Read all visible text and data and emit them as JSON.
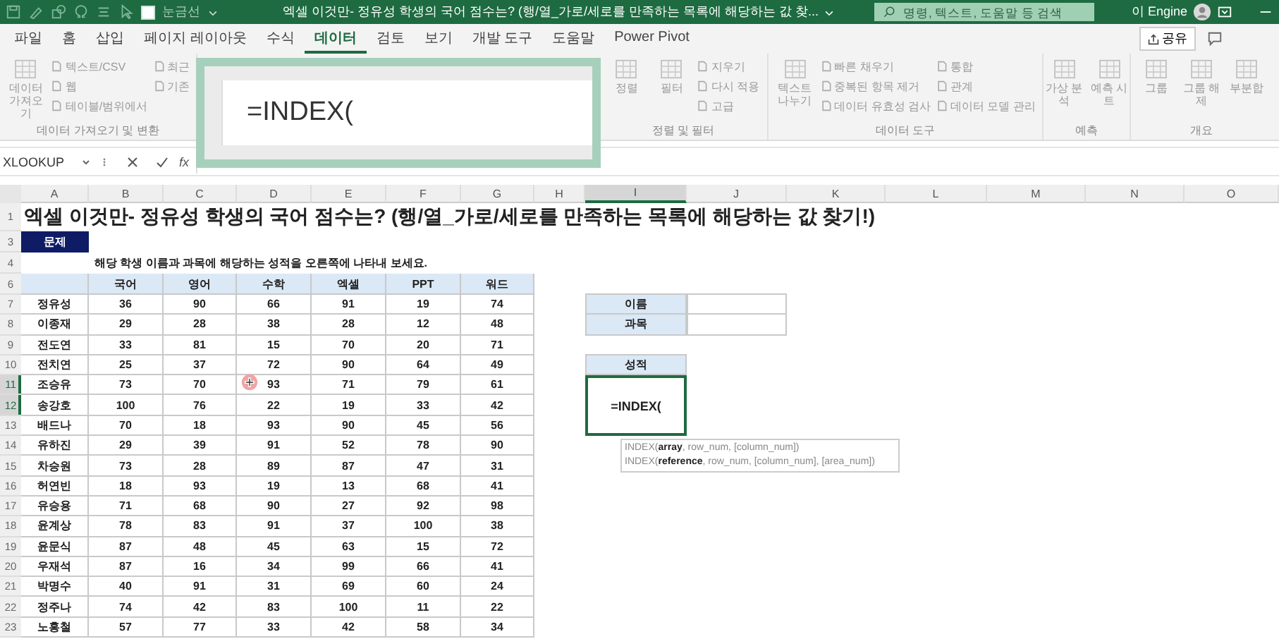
{
  "title_bar": {
    "gridlines_label": "눈금선",
    "gridlines_checked": false,
    "title": "엑셀 이것만- 정유성 학생의 국어 점수는? (행/열_가로/세로를 만족하는 목록에 해당하는 값 찾...",
    "search_placeholder": "명령, 텍스트, 도움말 등 검색",
    "user": "이 Engine"
  },
  "tabs": [
    {
      "label": "파일",
      "selected": false
    },
    {
      "label": "홈",
      "selected": false
    },
    {
      "label": "삽입",
      "selected": false
    },
    {
      "label": "페이지 레이아웃",
      "selected": false
    },
    {
      "label": "수식",
      "selected": false
    },
    {
      "label": "데이터",
      "selected": true
    },
    {
      "label": "검토",
      "selected": false
    },
    {
      "label": "보기",
      "selected": false
    },
    {
      "label": "개발 도구",
      "selected": false
    },
    {
      "label": "도움말",
      "selected": false
    },
    {
      "label": "Power Pivot",
      "selected": false
    }
  ],
  "share_label": "공유",
  "ribbon_groups": [
    {
      "label": "데이터 가져오기 및 변환",
      "columns": [
        {
          "kind": "large",
          "items": [
            "데이터 가져오기"
          ]
        },
        {
          "kind": "small",
          "items": [
            "텍스트/CSV",
            "웹",
            "테이블/범위에서"
          ]
        },
        {
          "kind": "small",
          "items": [
            "최근",
            "기존"
          ]
        }
      ]
    },
    {
      "label": "정렬 및 필터",
      "columns": [
        {
          "kind": "large",
          "items": [
            "정렬"
          ]
        },
        {
          "kind": "large",
          "items": [
            "필터"
          ]
        },
        {
          "kind": "small",
          "items": [
            "지우기",
            "다시 적용",
            "고급"
          ]
        }
      ]
    },
    {
      "label": "데이터 도구",
      "columns": [
        {
          "kind": "large",
          "items": [
            "텍스트 나누기"
          ]
        },
        {
          "kind": "small",
          "items": [
            "빠른 채우기",
            "중복된 항목 제거",
            "데이터 유효성 검사"
          ]
        },
        {
          "kind": "small",
          "items": [
            "통합",
            "관계",
            "데이터 모델 관리"
          ]
        }
      ]
    },
    {
      "label": "예측",
      "columns": [
        {
          "kind": "large",
          "items": [
            "가상 분석"
          ]
        },
        {
          "kind": "large",
          "items": [
            "예측 시트"
          ]
        }
      ]
    },
    {
      "label": "개요",
      "columns": [
        {
          "kind": "large",
          "items": [
            "그룹"
          ]
        },
        {
          "kind": "large",
          "items": [
            "그룹 해제"
          ]
        },
        {
          "kind": "large",
          "items": [
            "부분합"
          ]
        }
      ]
    }
  ],
  "formula_bar": {
    "name_box": "XLOOKUP",
    "function_label": "fx"
  },
  "formula_zoom": {
    "text": "=INDEX("
  },
  "sheet": {
    "columns": [
      {
        "label": "A",
        "selected": false
      },
      {
        "label": "B",
        "selected": false
      },
      {
        "label": "C",
        "selected": false
      },
      {
        "label": "D",
        "selected": false
      },
      {
        "label": "E",
        "selected": false
      },
      {
        "label": "F",
        "selected": false
      },
      {
        "label": "G",
        "selected": false
      },
      {
        "label": "H",
        "selected": false
      },
      {
        "label": "I",
        "selected": true
      },
      {
        "label": "J",
        "selected": false
      },
      {
        "label": "K",
        "selected": false
      },
      {
        "label": "L",
        "selected": false
      },
      {
        "label": "M",
        "selected": false
      },
      {
        "label": "N",
        "selected": false
      },
      {
        "label": "O",
        "selected": false
      }
    ],
    "rows": [
      {
        "number": "1",
        "selected": false,
        "kind": "title",
        "text": "엑셀 이것만- 정유성 학생의 국어 점수는? (행/열_가로/세로를 만족하는 목록에 해당하는 값 찾기!)"
      },
      {
        "number": "3",
        "selected": false,
        "kind": "label",
        "text": "문제"
      },
      {
        "number": "4",
        "selected": false,
        "kind": "note",
        "text": "해당 학생 이름과 과목에 해당하는 성적을 오른쪽에 나타내 보세요."
      },
      {
        "number": "6",
        "selected": false,
        "kind": "header",
        "cells": [
          "국어",
          "영어",
          "수학",
          "엑셀",
          "PPT",
          "워드"
        ]
      },
      {
        "number": "7",
        "selected": false,
        "kind": "data",
        "name": "정유성",
        "cells": [
          "36",
          "90",
          "66",
          "91",
          "19",
          "74"
        ],
        "side": {
          "kind": "label",
          "text": "이름"
        }
      },
      {
        "number": "8",
        "selected": false,
        "kind": "data",
        "name": "이종재",
        "cells": [
          "29",
          "28",
          "38",
          "28",
          "12",
          "48"
        ],
        "side": {
          "kind": "label",
          "text": "과목"
        }
      },
      {
        "number": "9",
        "selected": false,
        "kind": "data",
        "name": "전도연",
        "cells": [
          "33",
          "81",
          "15",
          "70",
          "20",
          "71"
        ]
      },
      {
        "number": "10",
        "selected": false,
        "kind": "data",
        "name": "전치연",
        "cells": [
          "25",
          "37",
          "72",
          "90",
          "64",
          "49"
        ],
        "side": {
          "kind": "heading",
          "text": "성적"
        }
      },
      {
        "number": "11",
        "selected": true,
        "kind": "data",
        "name": "조승유",
        "cells": [
          "73",
          "70",
          "93",
          "71",
          "79",
          "61"
        ],
        "side": {
          "kind": "formula",
          "text": "=INDEX(",
          "tooltip": [
            "INDEX(**array**, row_num, [column_num])",
            "INDEX(**reference**, row_num, [column_num], [area_num])"
          ]
        }
      },
      {
        "number": "12",
        "selected": true,
        "kind": "data",
        "name": "송강호",
        "cells": [
          "100",
          "76",
          "22",
          "19",
          "33",
          "42"
        ]
      },
      {
        "number": "13",
        "selected": false,
        "kind": "data",
        "name": "배드나",
        "cells": [
          "70",
          "18",
          "93",
          "90",
          "45",
          "56"
        ]
      },
      {
        "number": "14",
        "selected": false,
        "kind": "data",
        "name": "유하진",
        "cells": [
          "29",
          "39",
          "91",
          "52",
          "78",
          "90"
        ]
      },
      {
        "number": "15",
        "selected": false,
        "kind": "data",
        "name": "차승원",
        "cells": [
          "73",
          "28",
          "89",
          "87",
          "47",
          "31"
        ]
      },
      {
        "number": "16",
        "selected": false,
        "kind": "data",
        "name": "허연빈",
        "cells": [
          "18",
          "93",
          "19",
          "13",
          "68",
          "41"
        ]
      },
      {
        "number": "17",
        "selected": false,
        "kind": "data",
        "name": "유승용",
        "cells": [
          "71",
          "68",
          "90",
          "27",
          "92",
          "98"
        ]
      },
      {
        "number": "18",
        "selected": false,
        "kind": "data",
        "name": "윤계상",
        "cells": [
          "78",
          "83",
          "91",
          "37",
          "100",
          "38"
        ]
      },
      {
        "number": "19",
        "selected": false,
        "kind": "data",
        "name": "윤문식",
        "cells": [
          "87",
          "48",
          "45",
          "63",
          "15",
          "72"
        ]
      },
      {
        "number": "20",
        "selected": false,
        "kind": "data",
        "name": "우재석",
        "cells": [
          "87",
          "16",
          "34",
          "99",
          "66",
          "41"
        ]
      },
      {
        "number": "21",
        "selected": false,
        "kind": "data",
        "name": "박명수",
        "cells": [
          "40",
          "91",
          "31",
          "69",
          "60",
          "24"
        ]
      },
      {
        "number": "22",
        "selected": false,
        "kind": "data",
        "name": "정주나",
        "cells": [
          "74",
          "42",
          "83",
          "100",
          "11",
          "22"
        ]
      },
      {
        "number": "23",
        "selected": false,
        "kind": "data",
        "name": "노홍철",
        "cells": [
          "57",
          "77",
          "33",
          "42",
          "58",
          "34"
        ]
      }
    ]
  }
}
